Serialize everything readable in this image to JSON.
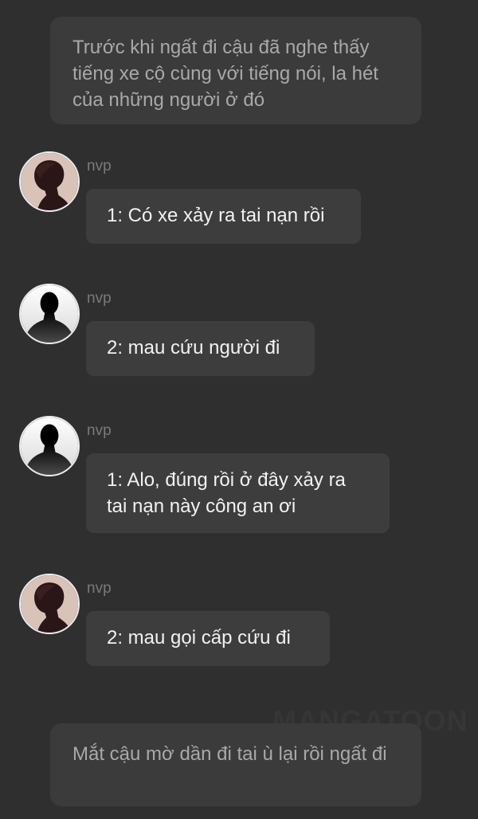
{
  "narration_top": "Trước khi ngất đi cậu đã nghe thấy tiếng xe cộ cùng với tiếng nói, la hét của những người ở đó",
  "messages": [
    {
      "speaker": "nvp",
      "text": "1: Có xe xảy ra tai nạn rồi",
      "avatar_icon": "anime-portrait-icon"
    },
    {
      "speaker": "nvp",
      "text": "2: mau cứu người đi",
      "avatar_icon": "silhouette-icon"
    },
    {
      "speaker": "nvp",
      "text": "1: Alo, đúng rồi ở đây xảy ra tai nạn này công an ơi",
      "avatar_icon": "silhouette-icon"
    },
    {
      "speaker": "nvp",
      "text": "2: mau gọi cấp cứu đi",
      "avatar_icon": "anime-portrait-icon"
    }
  ],
  "narration_bottom": "Mắt cậu mờ dần đi tai ù lại rồi ngất đi",
  "watermark": "MANGATOON",
  "colors": {
    "background": "#2f2f2f",
    "narration_box": "#3b3b3b",
    "bubble": "#3d3d3d",
    "narration_text": "#a9a9a9",
    "message_text": "#f2f2f2"
  }
}
